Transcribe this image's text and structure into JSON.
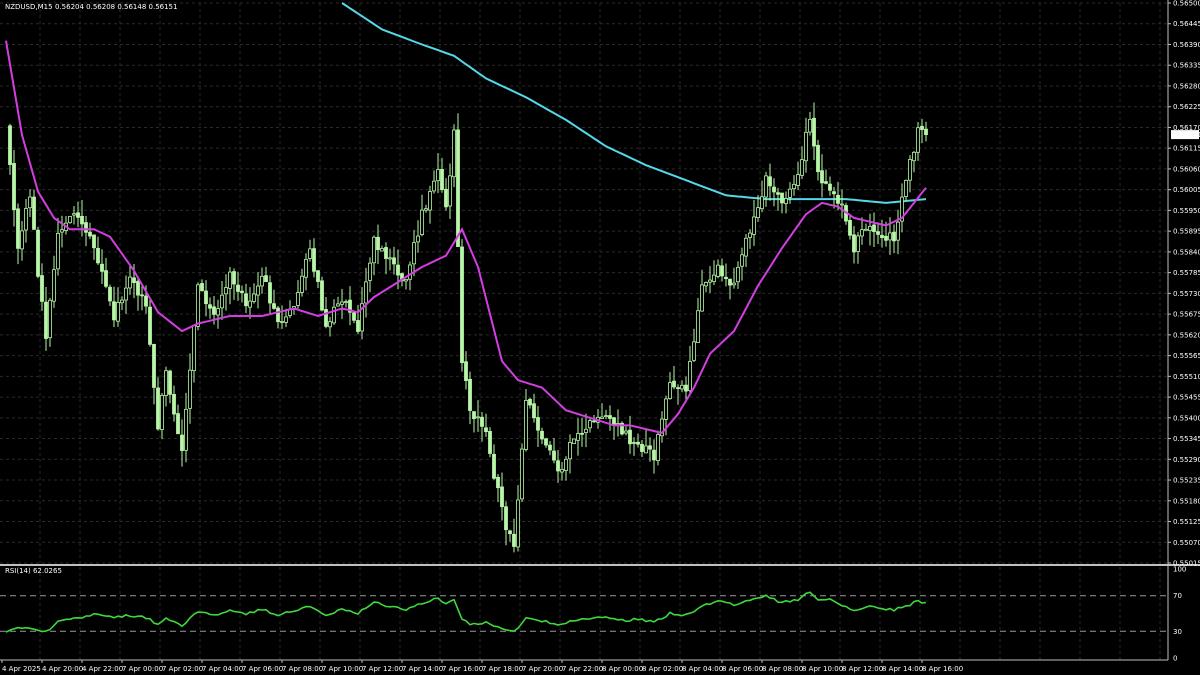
{
  "header": {
    "symbol": "NZDUSD,M15",
    "ohlc": "0.56204 0.56208 0.56148 0.56151"
  },
  "rsi_header": "RSI(14) 62.0265",
  "current_price_label": "0.56151",
  "colors": {
    "background": "#000000",
    "grid": "#2a2a2a",
    "frame": "#c0c0c0",
    "candle": "#b8f7a8",
    "ma_fast": "#d23ee0",
    "ma_slow": "#55d8e8",
    "rsi_line": "#3ed83e",
    "rsi_levels": "#9a9a9a",
    "price_tag_bg": "#ffffff",
    "price_tag_text": "#000000"
  },
  "chart_data": {
    "type": "candlestick",
    "timeframe": "M15",
    "ylim": [
      0.55015,
      0.565
    ],
    "y_ticks": [
      "0.56500",
      "0.56445",
      "0.56390",
      "0.56335",
      "0.56280",
      "0.56225",
      "0.56170",
      "0.56115",
      "0.56060",
      "0.56005",
      "0.55950",
      "0.55895",
      "0.55840",
      "0.55785",
      "0.55730",
      "0.55675",
      "0.55620",
      "0.55565",
      "0.55510",
      "0.55455",
      "0.55400",
      "0.55345",
      "0.55290",
      "0.55235",
      "0.55180",
      "0.55125",
      "0.55070",
      "0.55015"
    ],
    "x_tick_labels": [
      "4 Apr 2025",
      "4 Apr 20:00",
      "4 Apr 22:00",
      "7 Apr 00:00",
      "7 Apr 02:00",
      "7 Apr 04:00",
      "7 Apr 06:00",
      "7 Apr 08:00",
      "7 Apr 10:00",
      "7 Apr 12:00",
      "7 Apr 14:00",
      "7 Apr 16:00",
      "7 Apr 18:00",
      "7 Apr 20:00",
      "7 Apr 22:00",
      "8 Apr 00:00",
      "8 Apr 02:00",
      "8 Apr 04:00",
      "8 Apr 06:00",
      "8 Apr 08:00",
      "8 Apr 10:00",
      "8 Apr 12:00",
      "8 Apr 14:00",
      "8 Apr 16:00"
    ],
    "close_anchors": [
      [
        0,
        0.5618
      ],
      [
        3,
        0.5586
      ],
      [
        6,
        0.5598
      ],
      [
        10,
        0.556
      ],
      [
        13,
        0.559
      ],
      [
        18,
        0.5594
      ],
      [
        22,
        0.5586
      ],
      [
        27,
        0.5567
      ],
      [
        31,
        0.5576
      ],
      [
        35,
        0.557
      ],
      [
        38,
        0.5538
      ],
      [
        40,
        0.5552
      ],
      [
        44,
        0.553
      ],
      [
        48,
        0.5575
      ],
      [
        52,
        0.5566
      ],
      [
        56,
        0.5578
      ],
      [
        60,
        0.557
      ],
      [
        64,
        0.5578
      ],
      [
        68,
        0.5565
      ],
      [
        72,
        0.5571
      ],
      [
        76,
        0.5585
      ],
      [
        80,
        0.5565
      ],
      [
        84,
        0.5572
      ],
      [
        88,
        0.5564
      ],
      [
        92,
        0.5587
      ],
      [
        96,
        0.5582
      ],
      [
        100,
        0.5576
      ],
      [
        104,
        0.5594
      ],
      [
        108,
        0.5605
      ],
      [
        110,
        0.5595
      ],
      [
        112,
        0.5615
      ],
      [
        114,
        0.5555
      ],
      [
        116,
        0.5543
      ],
      [
        120,
        0.5535
      ],
      [
        124,
        0.5515
      ],
      [
        127,
        0.5505
      ],
      [
        130,
        0.5545
      ],
      [
        134,
        0.5535
      ],
      [
        138,
        0.5525
      ],
      [
        142,
        0.5535
      ],
      [
        146,
        0.5538
      ],
      [
        150,
        0.5542
      ],
      [
        154,
        0.5536
      ],
      [
        158,
        0.5533
      ],
      [
        162,
        0.553
      ],
      [
        166,
        0.555
      ],
      [
        170,
        0.5548
      ],
      [
        174,
        0.5575
      ],
      [
        178,
        0.558
      ],
      [
        182,
        0.5575
      ],
      [
        186,
        0.559
      ],
      [
        190,
        0.5603
      ],
      [
        194,
        0.5598
      ],
      [
        198,
        0.5603
      ],
      [
        201,
        0.562
      ],
      [
        203,
        0.5605
      ],
      [
        206,
        0.5601
      ],
      [
        209,
        0.5596
      ],
      [
        212,
        0.5585
      ],
      [
        215,
        0.5591
      ],
      [
        219,
        0.5589
      ],
      [
        222,
        0.5587
      ],
      [
        225,
        0.5603
      ],
      [
        228,
        0.5616
      ],
      [
        230,
        0.56151
      ]
    ],
    "ma_fast_anchors": [
      [
        0,
        0.564
      ],
      [
        4,
        0.5615
      ],
      [
        8,
        0.56
      ],
      [
        12,
        0.5593
      ],
      [
        16,
        0.559
      ],
      [
        22,
        0.559
      ],
      [
        26,
        0.5588
      ],
      [
        32,
        0.5579
      ],
      [
        38,
        0.5568
      ],
      [
        44,
        0.5563
      ],
      [
        48,
        0.5565
      ],
      [
        56,
        0.5567
      ],
      [
        64,
        0.5567
      ],
      [
        72,
        0.5569
      ],
      [
        78,
        0.5567
      ],
      [
        84,
        0.5569
      ],
      [
        88,
        0.5568
      ],
      [
        92,
        0.5572
      ],
      [
        98,
        0.5576
      ],
      [
        104,
        0.558
      ],
      [
        110,
        0.5583
      ],
      [
        114,
        0.559
      ],
      [
        118,
        0.558
      ],
      [
        124,
        0.5555
      ],
      [
        128,
        0.555
      ],
      [
        134,
        0.5548
      ],
      [
        140,
        0.5542
      ],
      [
        146,
        0.554
      ],
      [
        152,
        0.5538
      ],
      [
        156,
        0.5538
      ],
      [
        160,
        0.5537
      ],
      [
        164,
        0.5536
      ],
      [
        168,
        0.5541
      ],
      [
        172,
        0.5548
      ],
      [
        176,
        0.5557
      ],
      [
        182,
        0.5563
      ],
      [
        188,
        0.5575
      ],
      [
        194,
        0.5585
      ],
      [
        200,
        0.5594
      ],
      [
        204,
        0.5597
      ],
      [
        208,
        0.5596
      ],
      [
        212,
        0.5593
      ],
      [
        216,
        0.5592
      ],
      [
        220,
        0.5591
      ],
      [
        224,
        0.5593
      ],
      [
        230,
        0.5601
      ]
    ],
    "ma_slow_anchors": [
      [
        84,
        0.565
      ],
      [
        94,
        0.5643
      ],
      [
        104,
        0.5639
      ],
      [
        112,
        0.5636
      ],
      [
        120,
        0.563
      ],
      [
        130,
        0.5625
      ],
      [
        140,
        0.5619
      ],
      [
        150,
        0.5612
      ],
      [
        160,
        0.5607
      ],
      [
        170,
        0.5603
      ],
      [
        180,
        0.5599
      ],
      [
        190,
        0.5598
      ],
      [
        200,
        0.5598
      ],
      [
        210,
        0.5598
      ],
      [
        220,
        0.5597
      ],
      [
        230,
        0.5598
      ]
    ],
    "rsi": {
      "period": 14,
      "current": 62.0265,
      "levels": [
        70,
        30
      ],
      "y_ticks": [
        "100",
        "70",
        "30",
        "0"
      ],
      "anchors": [
        [
          0,
          30
        ],
        [
          3,
          35
        ],
        [
          6,
          33
        ],
        [
          10,
          30
        ],
        [
          13,
          40
        ],
        [
          18,
          45
        ],
        [
          22,
          50
        ],
        [
          27,
          45
        ],
        [
          31,
          48
        ],
        [
          35,
          45
        ],
        [
          38,
          38
        ],
        [
          40,
          44
        ],
        [
          44,
          36
        ],
        [
          48,
          52
        ],
        [
          52,
          48
        ],
        [
          56,
          54
        ],
        [
          60,
          50
        ],
        [
          64,
          55
        ],
        [
          68,
          48
        ],
        [
          72,
          53
        ],
        [
          76,
          58
        ],
        [
          80,
          48
        ],
        [
          84,
          55
        ],
        [
          88,
          50
        ],
        [
          92,
          62
        ],
        [
          96,
          58
        ],
        [
          100,
          55
        ],
        [
          104,
          62
        ],
        [
          108,
          68
        ],
        [
          110,
          60
        ],
        [
          112,
          66
        ],
        [
          114,
          44
        ],
        [
          116,
          38
        ],
        [
          120,
          40
        ],
        [
          124,
          32
        ],
        [
          127,
          29
        ],
        [
          130,
          46
        ],
        [
          134,
          42
        ],
        [
          138,
          38
        ],
        [
          142,
          42
        ],
        [
          146,
          44
        ],
        [
          150,
          46
        ],
        [
          154,
          42
        ],
        [
          158,
          44
        ],
        [
          162,
          40
        ],
        [
          166,
          50
        ],
        [
          170,
          48
        ],
        [
          174,
          58
        ],
        [
          178,
          64
        ],
        [
          182,
          60
        ],
        [
          186,
          65
        ],
        [
          190,
          70
        ],
        [
          194,
          62
        ],
        [
          198,
          66
        ],
        [
          201,
          75
        ],
        [
          203,
          64
        ],
        [
          206,
          66
        ],
        [
          209,
          60
        ],
        [
          212,
          52
        ],
        [
          215,
          58
        ],
        [
          219,
          55
        ],
        [
          222,
          54
        ],
        [
          225,
          58
        ],
        [
          228,
          64
        ],
        [
          230,
          62
        ]
      ]
    }
  }
}
